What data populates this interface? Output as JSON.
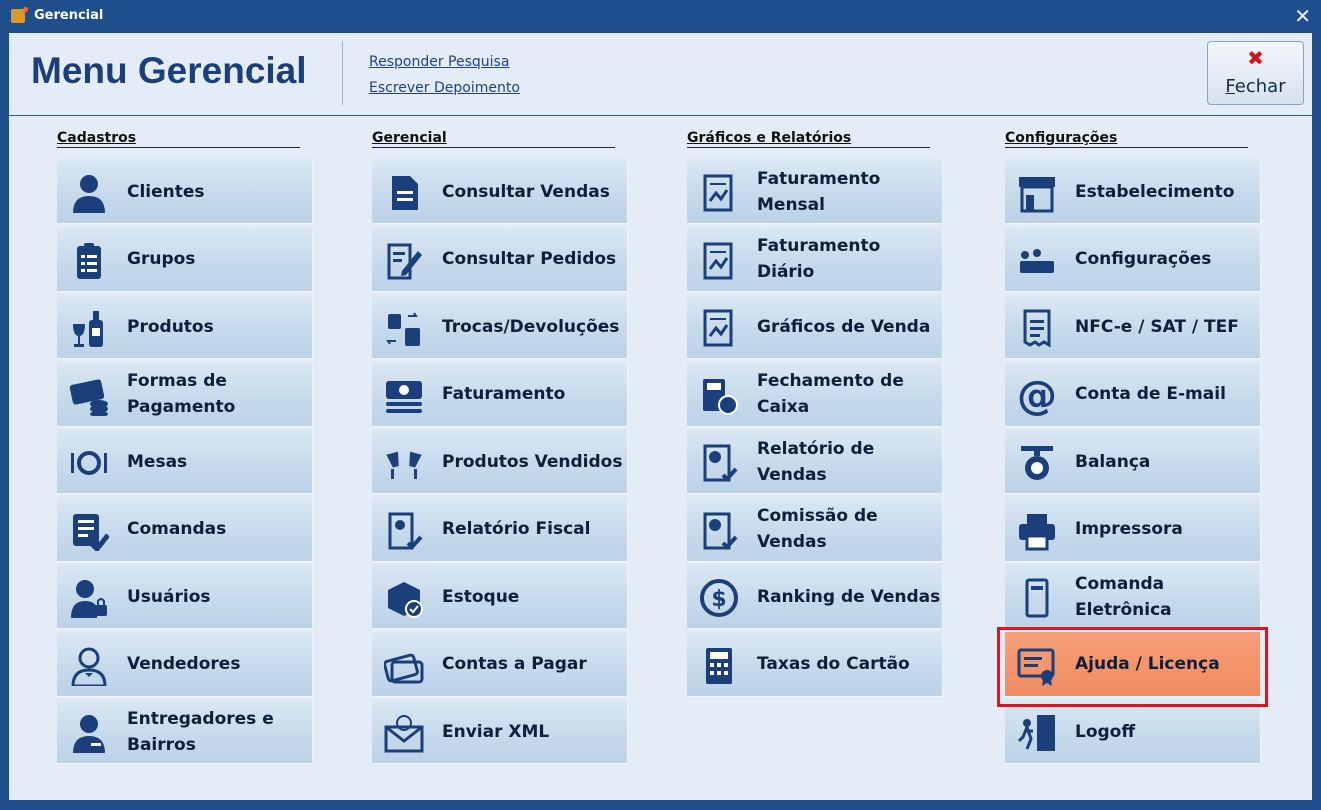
{
  "window": {
    "title": "Gerencial"
  },
  "header": {
    "title": "Menu Gerencial",
    "links": [
      "Responder Pesquisa",
      "Escrever Depoimento"
    ],
    "close_label": "Fechar"
  },
  "columns": [
    {
      "heading": "Cadastros",
      "items": [
        {
          "label": "Clientes",
          "icon": "user-icon"
        },
        {
          "label": "Grupos",
          "icon": "clipboard-list-icon"
        },
        {
          "label": "Produtos",
          "icon": "wine-bottle-icon"
        },
        {
          "label": "Formas de Pagamento",
          "icon": "card-coins-icon"
        },
        {
          "label": "Mesas",
          "icon": "plate-cutlery-icon"
        },
        {
          "label": "Comandas",
          "icon": "checklist-icon"
        },
        {
          "label": "Usuários",
          "icon": "user-lock-icon"
        },
        {
          "label": "Vendedores",
          "icon": "waiter-icon"
        },
        {
          "label": "Entregadores e Bairros",
          "icon": "delivery-person-icon"
        }
      ]
    },
    {
      "heading": "Gerencial",
      "items": [
        {
          "label": "Consultar Vendas",
          "icon": "document-icon"
        },
        {
          "label": "Consultar Pedidos",
          "icon": "edit-document-icon"
        },
        {
          "label": "Trocas/Devoluções",
          "icon": "shopping-bags-icon"
        },
        {
          "label": "Faturamento",
          "icon": "money-stack-icon"
        },
        {
          "label": "Produtos Vendidos",
          "icon": "toast-glasses-icon"
        },
        {
          "label": "Relatório Fiscal",
          "icon": "report-check-icon"
        },
        {
          "label": "Estoque",
          "icon": "box-check-icon"
        },
        {
          "label": "Contas a Pagar",
          "icon": "credit-cards-icon"
        },
        {
          "label": "Enviar XML",
          "icon": "envelope-at-icon"
        }
      ]
    },
    {
      "heading": "Gráficos e Relatórios",
      "items": [
        {
          "label": "Faturamento Mensal",
          "icon": "chart-report-icon"
        },
        {
          "label": "Faturamento Diário",
          "icon": "chart-report-icon"
        },
        {
          "label": "Gráficos de Venda",
          "icon": "chart-report-icon"
        },
        {
          "label": "Fechamento de Caixa",
          "icon": "calculator-dollar-icon"
        },
        {
          "label": "Relatório de Vendas",
          "icon": "pie-report-icon"
        },
        {
          "label": "Comissão de Vendas",
          "icon": "pie-report-icon"
        },
        {
          "label": "Ranking de Vendas",
          "icon": "dollar-circle-icon"
        },
        {
          "label": "Taxas do Cartão",
          "icon": "calculator-icon"
        }
      ]
    },
    {
      "heading": "Configurações",
      "items": [
        {
          "label": "Estabelecimento",
          "icon": "storefront-icon"
        },
        {
          "label": "Configurações",
          "icon": "workers-icon"
        },
        {
          "label": "NFC-e / SAT / TEF",
          "icon": "receipt-icon"
        },
        {
          "label": "Conta de E-mail",
          "icon": "at-sign-icon"
        },
        {
          "label": "Balança",
          "icon": "scale-icon"
        },
        {
          "label": "Impressora",
          "icon": "printer-icon"
        },
        {
          "label": "Comanda Eletrônica",
          "icon": "mobile-order-icon"
        },
        {
          "label": "Ajuda / Licença",
          "icon": "certificate-icon",
          "active": true
        },
        {
          "label": "Logoff",
          "icon": "exit-door-icon"
        }
      ]
    }
  ],
  "colors": {
    "accent": "#1b3f7a",
    "active_button": "#f18a5f",
    "highlight_border": "#e0141e"
  }
}
